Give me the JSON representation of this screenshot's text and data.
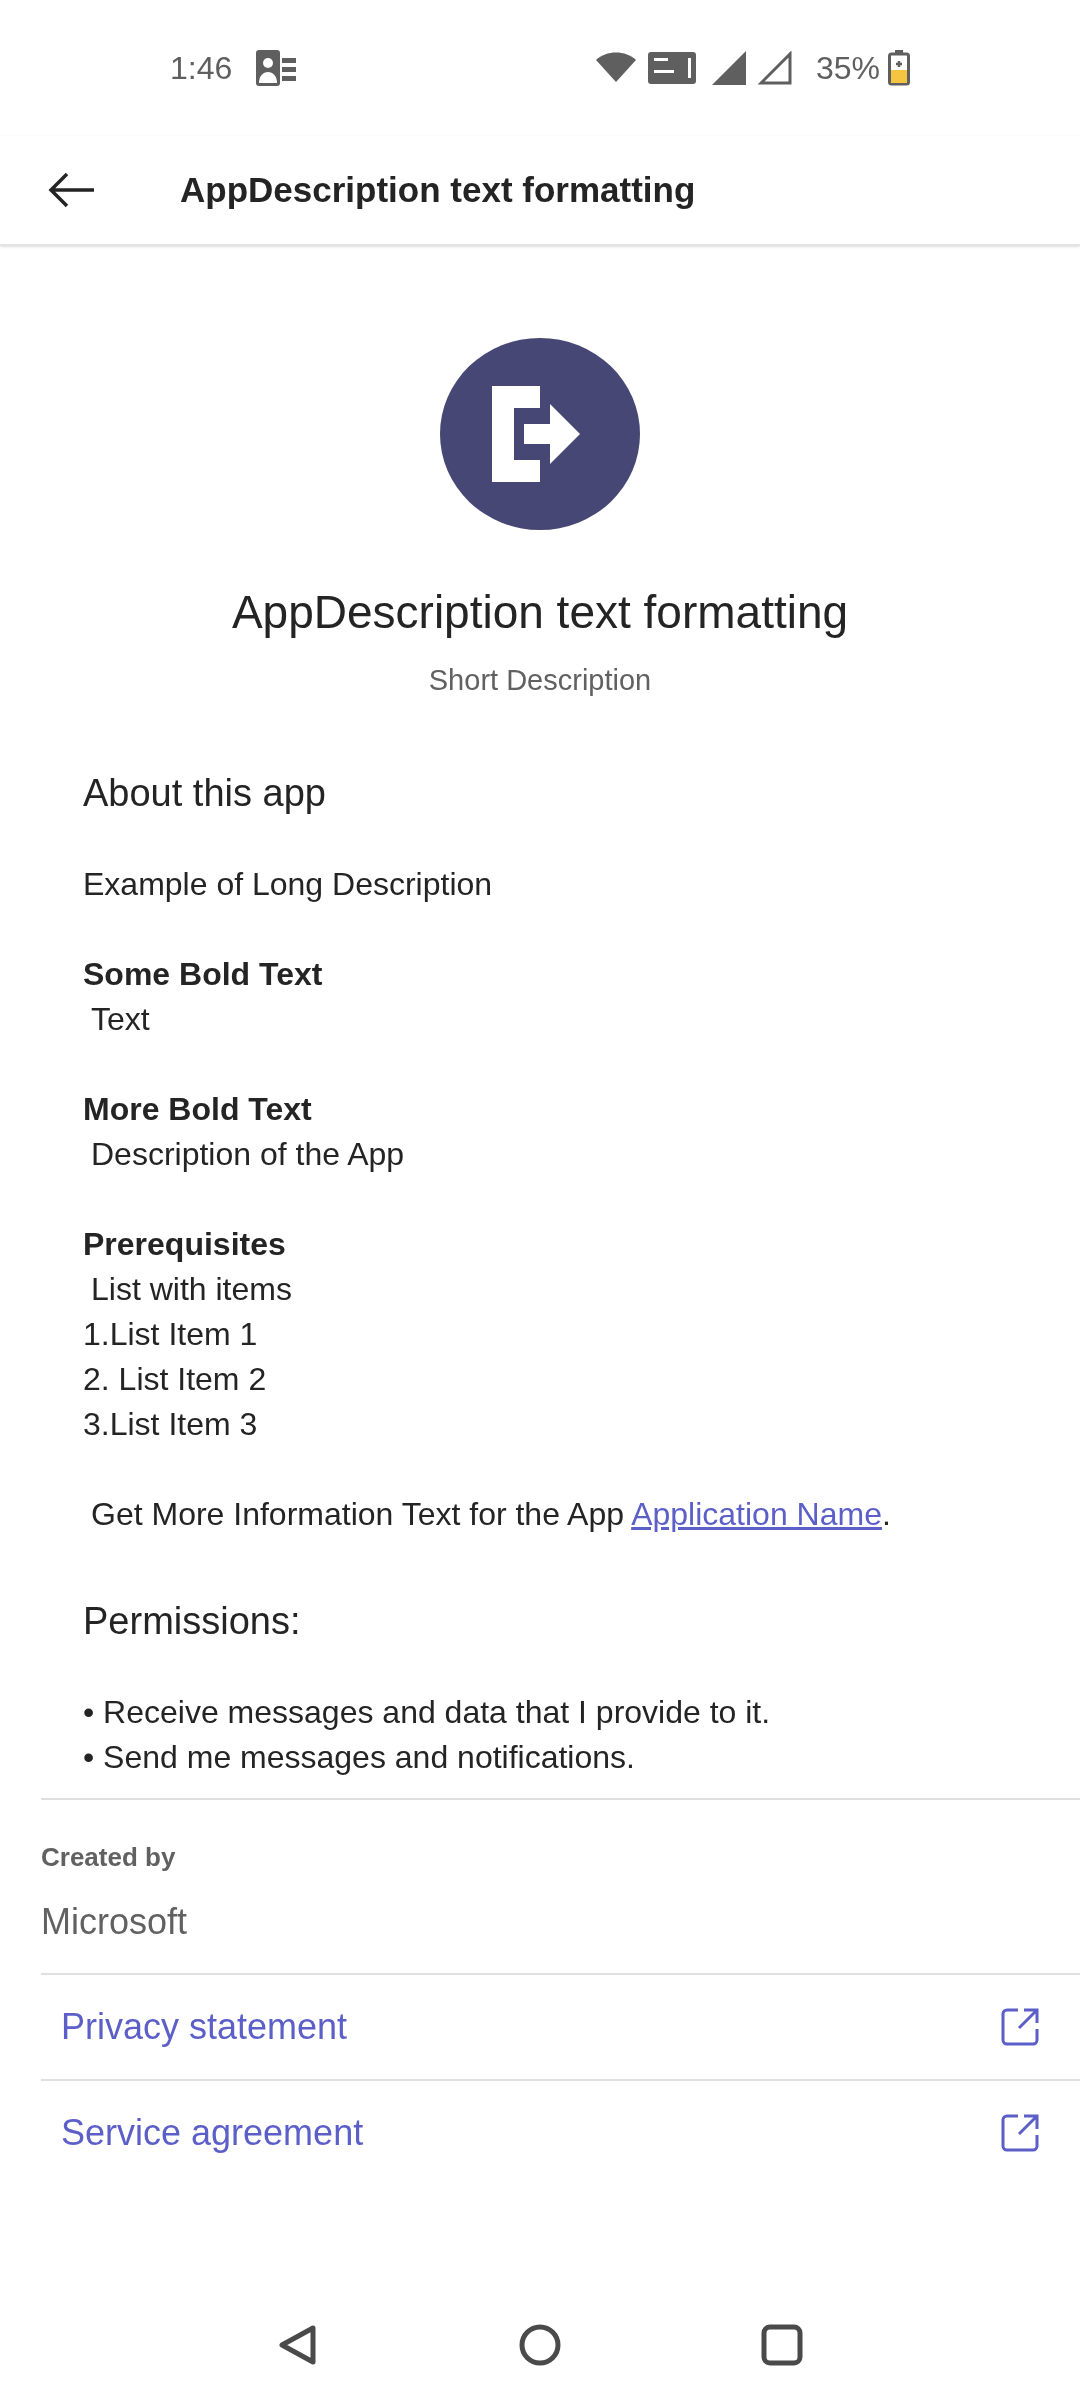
{
  "status_bar": {
    "time": "1:46",
    "battery": "35%"
  },
  "header": {
    "title": "AppDescription text formatting"
  },
  "app": {
    "title": "AppDescription text formatting",
    "short_description": "Short Description"
  },
  "about": {
    "heading": "About this app",
    "blocks": [
      {
        "kind": "text",
        "text": "Example of Long Description"
      },
      {
        "kind": "section",
        "heading": "Some Bold Text",
        "lines": [
          {
            "kind": "indented",
            "text": "Text"
          }
        ]
      },
      {
        "kind": "section",
        "heading": "More Bold Text",
        "lines": [
          {
            "kind": "indented",
            "text": "Description of the App"
          }
        ]
      },
      {
        "kind": "section",
        "heading": "Prerequisites",
        "lines": [
          {
            "kind": "indented",
            "text": "List with items"
          },
          {
            "kind": "plain",
            "text": "1.List Item 1"
          },
          {
            "kind": "plain",
            "text": "2. List Item 2"
          },
          {
            "kind": "plain",
            "text": "3.List Item 3"
          }
        ]
      },
      {
        "kind": "link_text",
        "text": "Get More Information Text for the App",
        "link": "Application Name",
        "after": "."
      }
    ]
  },
  "permissions": {
    "heading": "Permissions:",
    "items": [
      "• Receive messages and data that I provide to it.",
      "• Send me messages and notifications."
    ]
  },
  "created_by": {
    "label": "Created by",
    "value": "Microsoft"
  },
  "links": [
    "Privacy statement",
    "Service agreement"
  ]
}
